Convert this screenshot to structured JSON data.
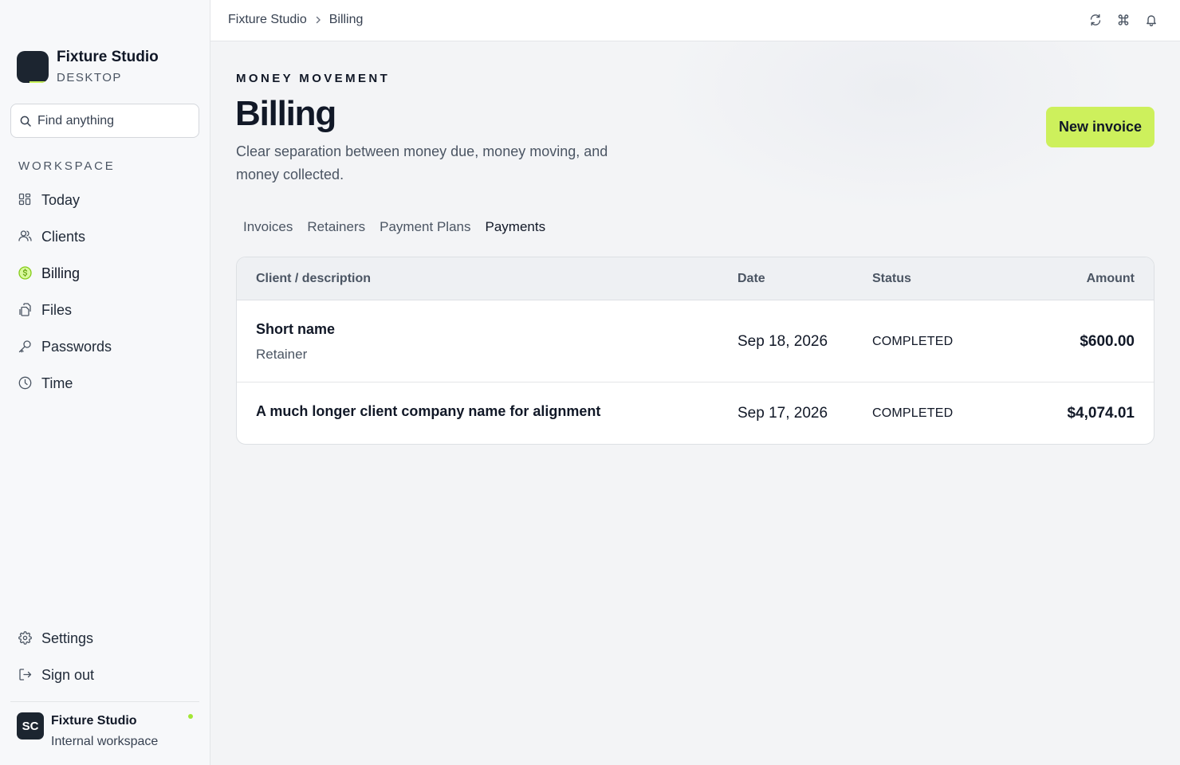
{
  "app": {
    "name": "Fixture Studio",
    "edition": "DESKTOP"
  },
  "search": {
    "placeholder": "Find anything"
  },
  "sidebar": {
    "section_label": "WORKSPACE",
    "items": [
      {
        "label": "Today",
        "icon": "dashboard-grid-icon"
      },
      {
        "label": "Clients",
        "icon": "users-icon"
      },
      {
        "label": "Billing",
        "icon": "dollar-circle-icon"
      },
      {
        "label": "Files",
        "icon": "files-icon"
      },
      {
        "label": "Passwords",
        "icon": "key-icon"
      },
      {
        "label": "Time",
        "icon": "clock-icon"
      }
    ],
    "active": "Billing",
    "bottom_items": [
      {
        "label": "Settings",
        "icon": "gear-icon"
      },
      {
        "label": "Sign out",
        "icon": "sign-out-icon"
      }
    ]
  },
  "user": {
    "initials": "SC",
    "name": "Fixture Studio",
    "subtitle": "Internal workspace",
    "status": "online"
  },
  "topbar": {
    "breadcrumb": [
      "Fixture Studio",
      "Billing"
    ],
    "icons": [
      "refresh-icon",
      "command-icon",
      "bell-icon"
    ]
  },
  "page": {
    "eyebrow": "MONEY MOVEMENT",
    "title": "Billing",
    "description": "Clear separation between money due, money moving, and money collected.",
    "primary_action": "New invoice"
  },
  "tabs": {
    "items": [
      "Invoices",
      "Retainers",
      "Payment Plans",
      "Payments"
    ],
    "active": "Payments"
  },
  "table": {
    "columns": {
      "client": "Client / description",
      "date": "Date",
      "status": "Status",
      "amount": "Amount"
    },
    "rows": [
      {
        "client": "Short name",
        "description": "Retainer",
        "date": "Sep 18, 2026",
        "status": "COMPLETED",
        "amount": "$600.00"
      },
      {
        "client": "A much longer client company name for alignment",
        "description": "",
        "date": "Sep 17, 2026",
        "status": "COMPLETED",
        "amount": "$4,074.01"
      }
    ]
  },
  "colors": {
    "accent": "#cdf05c",
    "online": "#a3e635",
    "sidebar_bg": "#f7f8fa",
    "dark": "#1c2530"
  }
}
